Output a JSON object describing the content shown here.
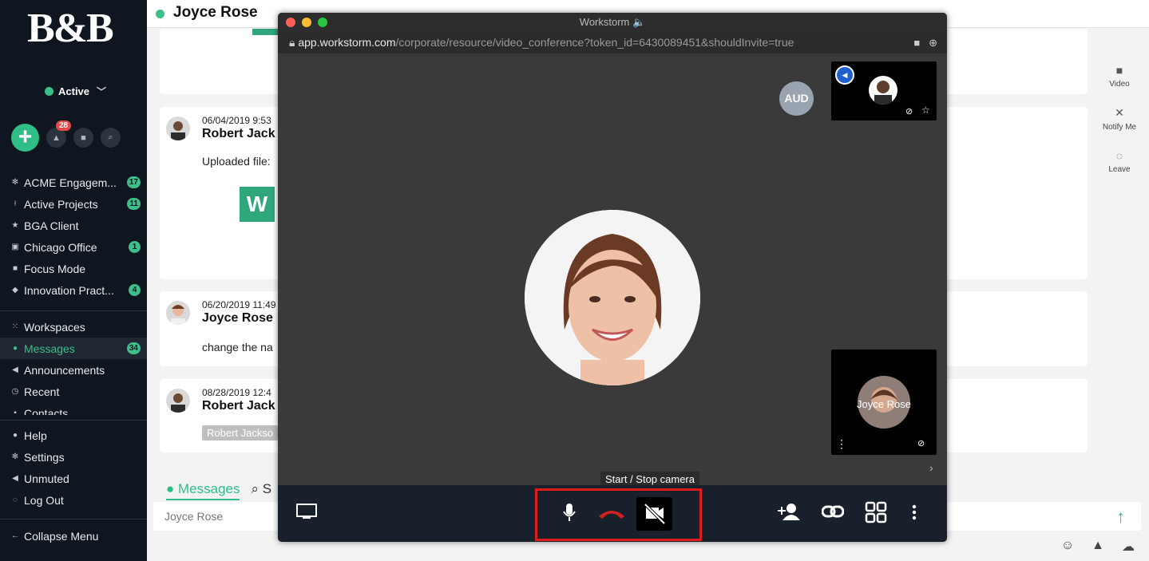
{
  "sidebar": {
    "logo": "B&B",
    "status": "Active",
    "notif_count": "28",
    "channels": [
      {
        "label": "ACME Engagem...",
        "count": "17",
        "icon": "gear-icon"
      },
      {
        "label": "Active Projects",
        "count": "11",
        "icon": "pin-icon"
      },
      {
        "label": "BGA Client",
        "count": "",
        "icon": "star-icon"
      },
      {
        "label": "Chicago Office",
        "count": "1",
        "icon": "briefcase-icon"
      },
      {
        "label": "Focus Mode",
        "count": "",
        "icon": "lock-icon"
      },
      {
        "label": "Innovation Pract...",
        "count": "4",
        "icon": "graduation-icon"
      }
    ],
    "nav": [
      {
        "label": "Workspaces",
        "count": "",
        "icon": "grid-icon"
      },
      {
        "label": "Messages",
        "count": "34",
        "icon": "chat-icon"
      },
      {
        "label": "Announcements",
        "count": "",
        "icon": "megaphone-icon"
      },
      {
        "label": "Recent",
        "count": "",
        "icon": "clock-icon"
      },
      {
        "label": "Contacts",
        "count": "",
        "icon": "contacts-icon"
      }
    ],
    "footer": [
      {
        "label": "Help",
        "icon": "help-icon"
      },
      {
        "label": "Settings",
        "icon": "gear-icon"
      },
      {
        "label": "Unmuted",
        "icon": "speaker-icon"
      },
      {
        "label": "Log Out",
        "icon": "logout-icon"
      }
    ],
    "collapse": "Collapse Menu"
  },
  "chat": {
    "title": "Joyce Rose",
    "messages": [
      {
        "time": "06/04/2019 9:53",
        "name": "Robert Jack",
        "text": "Uploaded file:"
      },
      {
        "time": "06/20/2019 11:49",
        "name": "Joyce Rose",
        "text": "change the na"
      },
      {
        "time": "08/28/2019 12:4",
        "name": "Robert Jack",
        "chip": "Robert Jackso"
      }
    ],
    "file_letter": "W",
    "tab_messages": "Messages",
    "tab_search": "S",
    "composer_placeholder": "Joyce Rose",
    "right_actions": [
      {
        "label": "Video"
      },
      {
        "label": "Notify Me"
      },
      {
        "label": "Leave"
      }
    ]
  },
  "video": {
    "window_title": "Workstorm 🔈",
    "url_host": "app.workstorm.com",
    "url_path": "/corporate/resource/video_conference?token_id=6430089451&shouldInvite=true",
    "aud_label": "AUD",
    "self_name": "Joyce Rose",
    "tooltip": "Start / Stop camera"
  }
}
